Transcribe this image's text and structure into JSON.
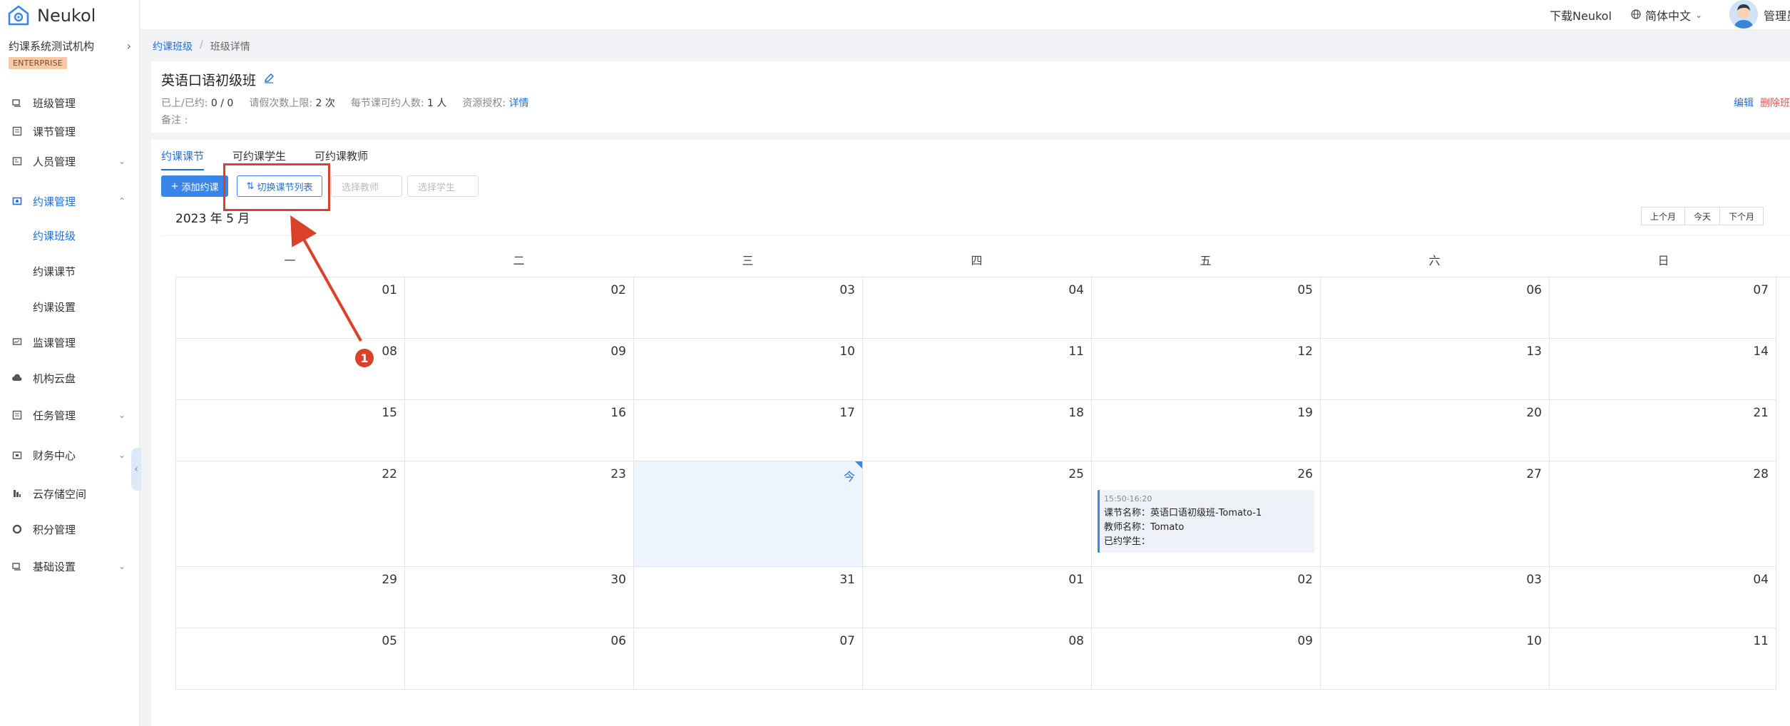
{
  "app": {
    "name": "Neukol"
  },
  "sidebar": {
    "org_name": "约课系统测试机构",
    "badge": "ENTERPRISE",
    "items": [
      {
        "label": "班级管理",
        "icon": "class-icon"
      },
      {
        "label": "课节管理",
        "icon": "lesson-icon"
      },
      {
        "label": "人员管理",
        "icon": "people-icon"
      },
      {
        "label": "约课管理",
        "icon": "booking-icon"
      },
      {
        "label": "约课班级",
        "icon": ""
      },
      {
        "label": "约课课节",
        "icon": ""
      },
      {
        "label": "约课设置",
        "icon": ""
      },
      {
        "label": "监课管理",
        "icon": "monitor-icon"
      },
      {
        "label": "机构云盘",
        "icon": "cloud-icon"
      },
      {
        "label": "任务管理",
        "icon": "task-icon"
      },
      {
        "label": "财务中心",
        "icon": "finance-icon"
      },
      {
        "label": "云存储空间",
        "icon": "storage-icon"
      },
      {
        "label": "积分管理",
        "icon": "points-icon"
      },
      {
        "label": "基础设置",
        "icon": "settings-icon"
      }
    ]
  },
  "topbar": {
    "download": "下载Neukol",
    "language": "简体中文",
    "user": "管理员"
  },
  "breadcrumb": {
    "parent": "约课班级",
    "current": "班级详情"
  },
  "header": {
    "title": "英语口语初级班",
    "stats": [
      {
        "label": "已上/已约:",
        "value": "0 / 0"
      },
      {
        "label": "请假次数上限:",
        "value": "2 次"
      },
      {
        "label": "每节课可约人数:",
        "value": "1 人"
      },
      {
        "label": "资源授权:",
        "value": "详情"
      }
    ],
    "remark_label": "备注 :",
    "edit": "编辑",
    "delete": "删除班级"
  },
  "tabs": [
    "约课课节",
    "可约课学生",
    "可约课教师"
  ],
  "toolbar": {
    "add": "添加约课",
    "switch": "切换课节列表",
    "teacher_placeholder": "选择教师",
    "student_placeholder": "选择学生"
  },
  "calendar": {
    "month_label": "2023 年 5 月",
    "nav": [
      "上个月",
      "今天",
      "下个月"
    ],
    "weekdays": [
      "一",
      "二",
      "三",
      "四",
      "五",
      "六",
      "日"
    ],
    "weeks": [
      [
        "01",
        "02",
        "03",
        "04",
        "05",
        "06",
        "07"
      ],
      [
        "08",
        "09",
        "10",
        "11",
        "12",
        "13",
        "14"
      ],
      [
        "15",
        "16",
        "17",
        "18",
        "19",
        "20",
        "21"
      ],
      [
        "22",
        "23",
        "今",
        "25",
        "26",
        "27",
        "28"
      ],
      [
        "29",
        "30",
        "31",
        "01",
        "02",
        "03",
        "04"
      ],
      [
        "05",
        "06",
        "07",
        "08",
        "09",
        "10",
        "11"
      ]
    ],
    "event": {
      "time": "15:50-16:20",
      "lesson": "课节名称：英语口语初级班-Tomato-1",
      "teacher": "教师名称：Tomato",
      "students": "已约学生："
    }
  },
  "annotation": {
    "number": "1"
  }
}
